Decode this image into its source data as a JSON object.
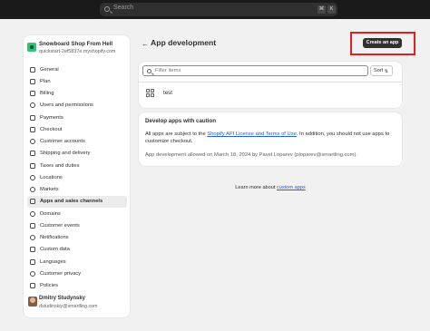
{
  "topbar": {
    "search_placeholder": "Search",
    "shortcut_keys": [
      "⌘",
      "K"
    ]
  },
  "store": {
    "name": "Snowboard Shop From Hell",
    "url": "quickstart-2ef5837e.myshopify.com"
  },
  "nav": {
    "items": [
      {
        "label": "General",
        "icon": "store-icon"
      },
      {
        "label": "Plan",
        "icon": "plan-icon"
      },
      {
        "label": "Billing",
        "icon": "billing-icon"
      },
      {
        "label": "Users and permissions",
        "icon": "users-icon"
      },
      {
        "label": "Payments",
        "icon": "payments-icon"
      },
      {
        "label": "Checkout",
        "icon": "checkout-icon"
      },
      {
        "label": "Customer accounts",
        "icon": "customer-accounts-icon"
      },
      {
        "label": "Shipping and delivery",
        "icon": "shipping-icon"
      },
      {
        "label": "Taxes and duties",
        "icon": "taxes-icon"
      },
      {
        "label": "Locations",
        "icon": "location-icon"
      },
      {
        "label": "Markets",
        "icon": "globe-icon"
      },
      {
        "label": "Apps and sales channels",
        "icon": "apps-icon",
        "active": true
      },
      {
        "label": "Domains",
        "icon": "domains-icon"
      },
      {
        "label": "Customer events",
        "icon": "events-icon"
      },
      {
        "label": "Notifications",
        "icon": "bell-icon"
      },
      {
        "label": "Custom data",
        "icon": "custom-data-icon"
      },
      {
        "label": "Languages",
        "icon": "languages-icon"
      },
      {
        "label": "Customer privacy",
        "icon": "privacy-icon"
      },
      {
        "label": "Policies",
        "icon": "policies-icon"
      }
    ]
  },
  "user": {
    "name": "Dmitry Studynsky",
    "email": "dstudinskiy@smartling.com"
  },
  "main": {
    "title": "App development",
    "create_button": "Create an app",
    "filter_placeholder": "Filter items",
    "sort_label": "Sort",
    "apps": [
      {
        "name": "test"
      }
    ],
    "caution": {
      "title": "Develop apps with caution",
      "body_prefix": "All apps are subject to the ",
      "body_link": "Shopify API License and Terms of Use",
      "body_suffix": ". In addition, you should not use apps to customize checkout.",
      "meta": "App development allowed on March 18, 2024 by Pavel Loparev (ploparev@smartling.com)."
    },
    "learn_prefix": "Learn more about ",
    "learn_link": "custom apps"
  },
  "colors": {
    "highlight": "#e02020",
    "primary_button": "#303030",
    "link": "#2463d1",
    "topbar": "#1a1a1a"
  }
}
